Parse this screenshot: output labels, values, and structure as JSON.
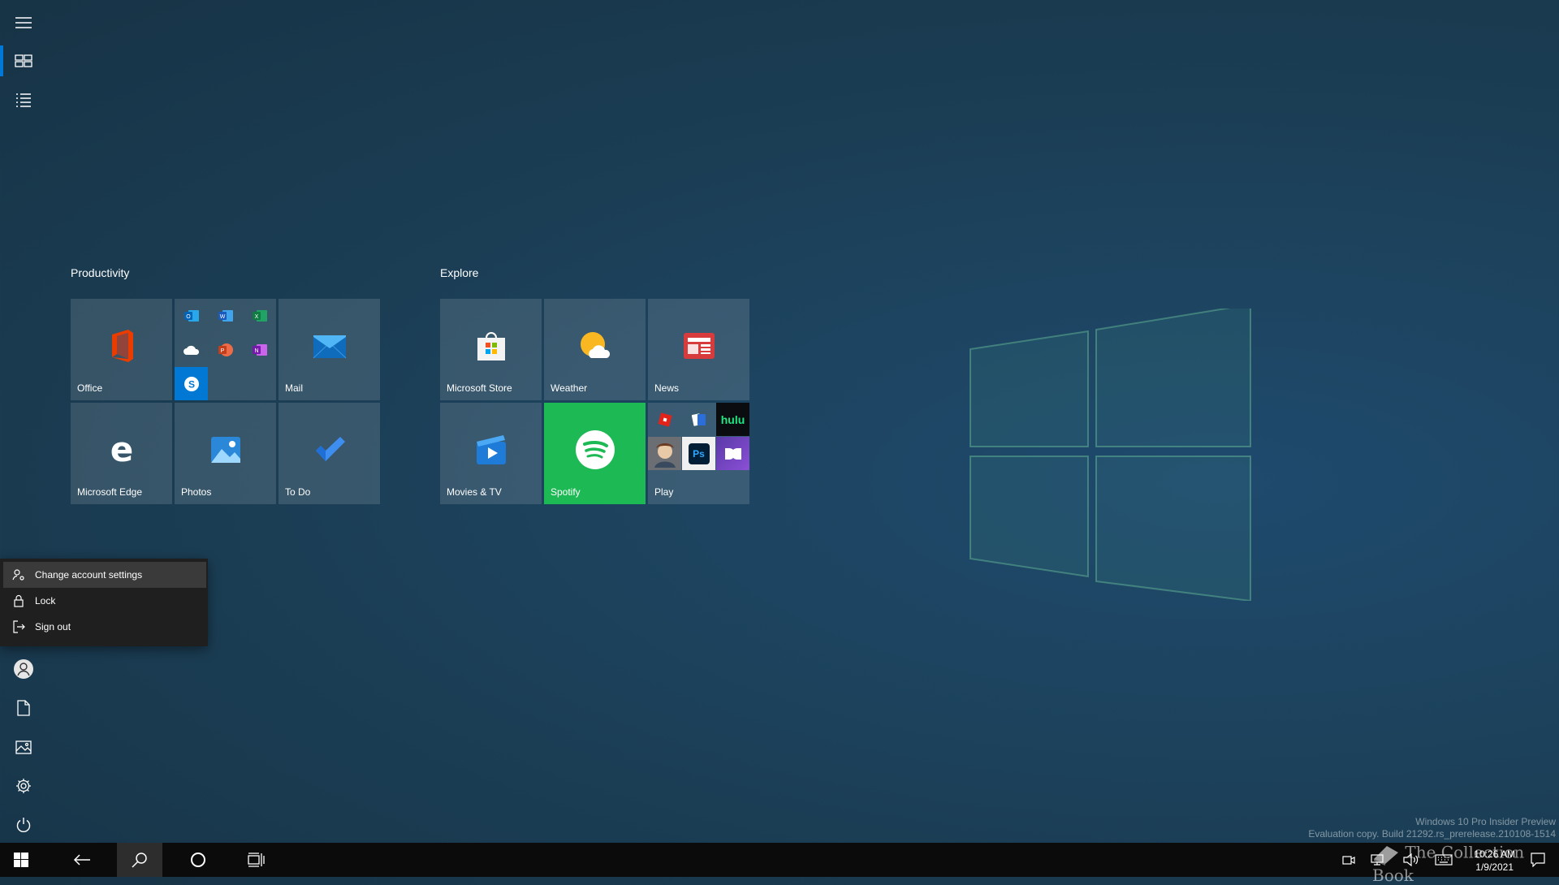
{
  "groups": [
    {
      "title": "Productivity"
    },
    {
      "title": "Explore"
    }
  ],
  "tiles": {
    "office": "Office",
    "mail": "Mail",
    "edge": "Microsoft Edge",
    "photos": "Photos",
    "todo": "To Do",
    "store": "Microsoft Store",
    "weather": "Weather",
    "news": "News",
    "movies": "Movies & TV",
    "spotify": "Spotify",
    "play": "Play"
  },
  "office_apps": [
    "Outlook",
    "Word",
    "Excel",
    "OneDrive",
    "PowerPoint",
    "OneNote",
    "Skype"
  ],
  "play_apps": {
    "hulu": "hulu",
    "photoshop": "Ps"
  },
  "account_menu": [
    "Change account settings",
    "Lock",
    "Sign out"
  ],
  "rail_icons": [
    "hamburger-icon",
    "tiles-icon",
    "list-icon",
    "user-icon",
    "document-icon",
    "pictures-icon",
    "settings-icon",
    "power-icon"
  ],
  "taskbar": {
    "time": "10:26 AM",
    "date": "1/9/2021"
  },
  "watermark": {
    "line1": "Windows 10 Pro Insider Preview",
    "line2": "Evaluation copy. Build 21292.rs_prerelease.210108-1514"
  },
  "overlay_text": "The Collection Book",
  "colors": {
    "accent": "#0078d7",
    "spotify": "#1db954",
    "menu_bg": "#1f1f1f",
    "taskbar": "#0b0b0b"
  }
}
